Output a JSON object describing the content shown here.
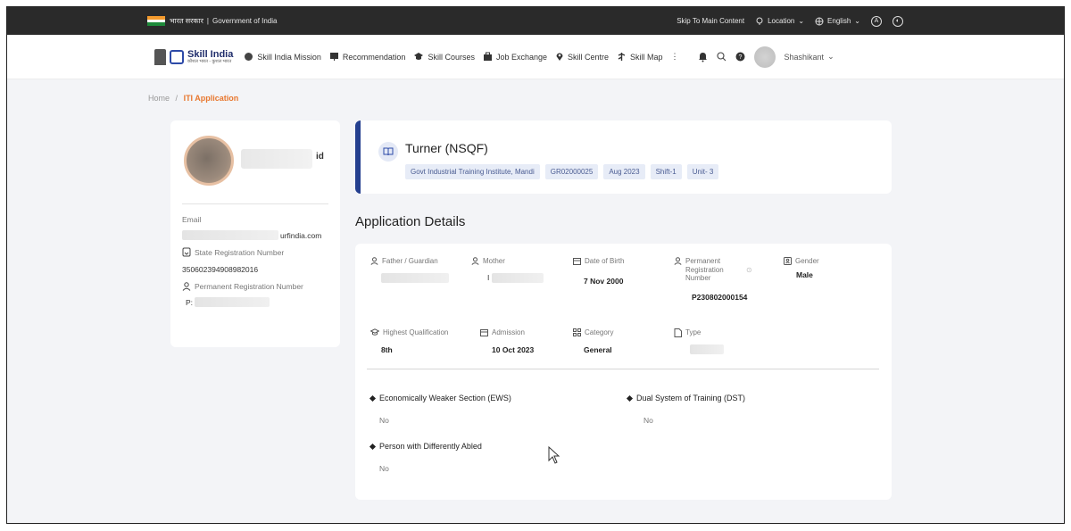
{
  "gov_bar": {
    "hindi_text": "भारत सरकार",
    "separator": "|",
    "english_text": "Government of India",
    "skip_link": "Skip To Main Content",
    "location_label": "Location",
    "language_label": "English",
    "accessibility_label": "A"
  },
  "nav": {
    "logo_text": "Skill India",
    "logo_subtext": "कौशल भारत - कुशल भारत",
    "items": [
      {
        "label": "Skill India Mission",
        "icon": "shield-icon"
      },
      {
        "label": "Recommendation",
        "icon": "board-icon"
      },
      {
        "label": "Skill Courses",
        "icon": "graduation-cap-icon"
      },
      {
        "label": "Job Exchange",
        "icon": "briefcase-icon"
      },
      {
        "label": "Skill Centre",
        "icon": "location-pin-icon"
      },
      {
        "label": "Skill Map",
        "icon": "map-icon"
      }
    ],
    "more_label": "⋮",
    "user_name": "Shashikant"
  },
  "breadcrumb": {
    "home": "Home",
    "separator": "/",
    "current": "ITI Application"
  },
  "profile": {
    "name_suffix": "id",
    "email_label": "Email",
    "email_suffix": "urfindia.com",
    "state_reg_label": "State Registration Number",
    "state_reg_value": "350602394908982016",
    "perm_reg_label": "Permanent Registration Number",
    "perm_reg_prefix": "P:"
  },
  "course": {
    "title": "Turner (NSQF)",
    "chips": [
      "Govt Industrial Training Institute, Mandi",
      "GR02000025",
      "Aug 2023",
      "Shift-1",
      "Unit- 3"
    ]
  },
  "application": {
    "section_title": "Application Details",
    "father_label": "Father / Guardian",
    "mother_label": "Mother",
    "mother_prefix": "I",
    "dob_label": "Date of Birth",
    "dob_value": "7 Nov 2000",
    "perm_reg_label": "Permanent Registration Number",
    "perm_reg_value": "P230802000154",
    "gender_label": "Gender",
    "gender_value": "Male",
    "qualification_label": "Highest Qualification",
    "qualification_value": "8th",
    "admission_label": "Admission",
    "admission_value": "10 Oct 2023",
    "category_label": "Category",
    "category_value": "General",
    "type_label": "Type",
    "ews_label": "Economically Weaker Section (EWS)",
    "ews_value": "No",
    "dst_label": "Dual System of Training (DST)",
    "dst_value": "No",
    "pwd_label": "Person with Differently Abled",
    "pwd_value": "No"
  },
  "colors": {
    "accent_orange": "#e8772e",
    "course_border": "#243f8f",
    "chip_bg": "#e7ecf7",
    "gov_bar_bg": "#2a2a2a"
  }
}
